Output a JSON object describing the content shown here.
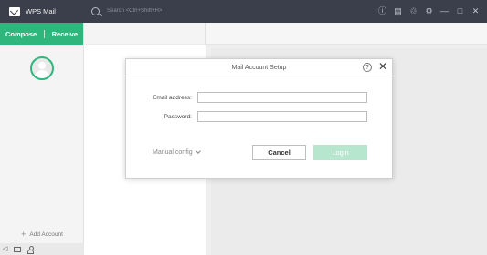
{
  "app": {
    "title": "WPS Mail"
  },
  "search": {
    "placeholder": "Search <Ctrl+Shift+H>"
  },
  "titlebar_icons": [
    "info-icon",
    "feedback-icon",
    "sync-icon",
    "settings-icon",
    "minimize-icon",
    "maximize-icon",
    "close-icon"
  ],
  "sidebar": {
    "compose_label": "Compose",
    "receive_label": "Receive",
    "add_account_label": "Add Account",
    "accent_color": "#2eb67d"
  },
  "dialog": {
    "title": "Mail Account Setup",
    "email_label": "Email address:",
    "email_value": "",
    "password_label": "Password:",
    "password_value": "",
    "manual_config_label": "Manual config",
    "cancel_label": "Cancel",
    "login_label": "Login",
    "login_color": "#b7e6cf"
  }
}
